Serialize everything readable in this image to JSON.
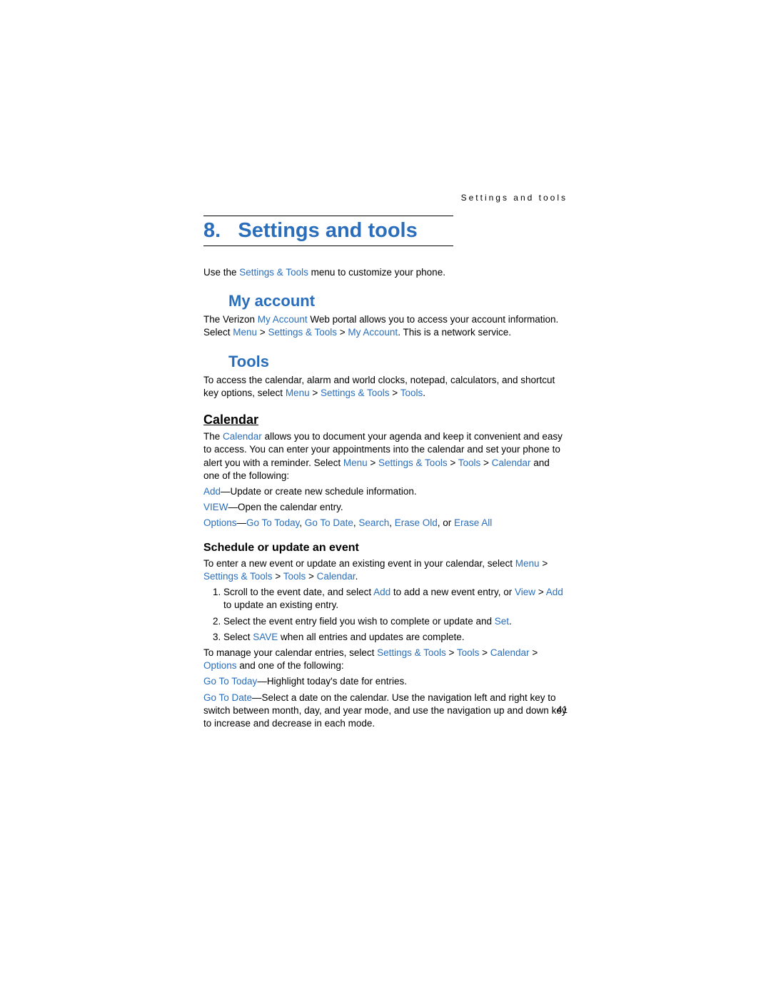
{
  "runningHead": "Settings and tools",
  "chapter": {
    "number": "8.",
    "title": "Settings and tools"
  },
  "intro": {
    "t1": "Use the ",
    "l1": "Settings & Tools",
    "t2": " menu to customize your phone."
  },
  "myAccount": {
    "heading": "My account",
    "p1a": "The Verizon ",
    "p1l1": "My Account",
    "p1b": " Web portal allows you to access your account information. Select ",
    "p1l2": "Menu",
    "p1c": " > ",
    "p1l3": "Settings & Tools",
    "p1d": " > ",
    "p1l4": "My Account",
    "p1e": ". This is a network service."
  },
  "tools": {
    "heading": "Tools",
    "p1a": "To access the calendar, alarm and world clocks, notepad, calculators, and shortcut key options, select ",
    "p1l1": "Menu",
    "p1b": " > ",
    "p1l2": "Settings & Tools",
    "p1c": " > ",
    "p1l3": "Tools",
    "p1d": "."
  },
  "calendar": {
    "heading": "Calendar",
    "p1a": "The ",
    "p1l1": "Calendar",
    "p1b": " allows you to document your agenda and keep it convenient and easy to access. You can enter your appointments into the calendar and set your phone to alert you with a reminder. Select ",
    "p1l2": "Menu",
    "p1c": " > ",
    "p1l3": "Settings & Tools",
    "p1d": " > ",
    "p1l4": "Tools",
    "p1e": " > ",
    "p1l5": "Calendar",
    "p1f": " and one of the following:",
    "add_l": "Add",
    "add_t": "—Update or create new schedule information.",
    "view_l": "VIEW",
    "view_t": "—Open the calendar entry.",
    "opt_l1": "Options",
    "opt_t1": "—",
    "opt_l2": "Go To Today",
    "opt_t2": ", ",
    "opt_l3": "Go To Date",
    "opt_t3": ", ",
    "opt_l4": "Search",
    "opt_t4": ", ",
    "opt_l5": "Erase Old",
    "opt_t5": ", or ",
    "opt_l6": "Erase All"
  },
  "schedule": {
    "heading": "Schedule or update an event",
    "p1a": "To enter a new event or update an existing event in your calendar, select ",
    "p1l1": "Menu",
    "p1b": " > ",
    "p1l2": "Settings & Tools",
    "p1c": " > ",
    "p1l3": "Tools",
    "p1d": " > ",
    "p1l4": "Calendar",
    "p1e": ".",
    "li1a": "Scroll to the event date, and select ",
    "li1l1": "Add",
    "li1b": " to add a new event entry, or ",
    "li1l2": "View",
    "li1c": " > ",
    "li1l3": "Add",
    "li1d": " to update an existing entry.",
    "li2a": "Select the event entry field you wish to complete or update and ",
    "li2l1": "Set",
    "li2b": ".",
    "li3a": "Select ",
    "li3l1": "SAVE",
    "li3b": " when all entries and updates are complete.",
    "p2a": "To manage your calendar entries, select ",
    "p2l1": "Settings & Tools",
    "p2b": " > ",
    "p2l2": "Tools",
    "p2c": " > ",
    "p2l3": "Calendar",
    "p2d": " > ",
    "p2l4": "Options",
    "p2e": " and one of the following:",
    "gt_l": "Go To Today",
    "gt_t": "—Highlight today's date for entries.",
    "gd_l": "Go To Date",
    "gd_t": "—Select a date on the calendar. Use the navigation left and right key to switch between month, day, and year mode, and use the navigation up and down key to increase and decrease in each mode."
  },
  "pageNumber": "41"
}
